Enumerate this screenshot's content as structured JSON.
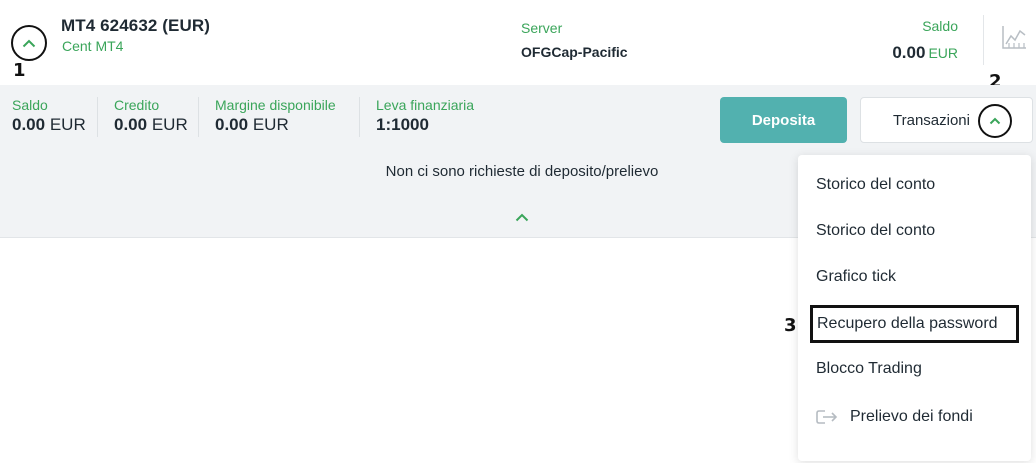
{
  "account": {
    "title": "MT4 624632 (EUR)",
    "type": "Cent MT4",
    "server_label": "Server",
    "server_value": "OFGCap-Pacific",
    "saldo_label": "Saldo",
    "saldo_amount": "0.00",
    "saldo_currency": "EUR"
  },
  "markers": {
    "m1": "1",
    "m2": "2",
    "m3": "3"
  },
  "stats": [
    {
      "label": "Saldo",
      "amount": "0.00",
      "currency": "EUR"
    },
    {
      "label": "Credito",
      "amount": "0.00",
      "currency": "EUR"
    },
    {
      "label": "Margine disponibile",
      "amount": "0.00",
      "currency": "EUR"
    },
    {
      "label": "Leva finanziaria",
      "amount": "1:1000",
      "currency": ""
    }
  ],
  "actions": {
    "deposit": "Deposita",
    "transactions": "Transazioni"
  },
  "empty_message": "Non ci sono richieste di deposito/prelievo",
  "menu": {
    "items": [
      {
        "label": "Storico del conto"
      },
      {
        "label": "Storico del conto"
      },
      {
        "label": "Grafico tick"
      },
      {
        "label": "Recupero della password"
      },
      {
        "label": "Blocco Trading"
      },
      {
        "label": "Prelievo dei fondi"
      }
    ]
  },
  "colors": {
    "accent_green": "#3aa55a",
    "deposit_button": "#52b1af",
    "panel_bg": "#f1f3f5",
    "annotation": "#111111"
  },
  "icons": [
    "chevron-up-icon",
    "chart-icon",
    "exit-icon"
  ]
}
